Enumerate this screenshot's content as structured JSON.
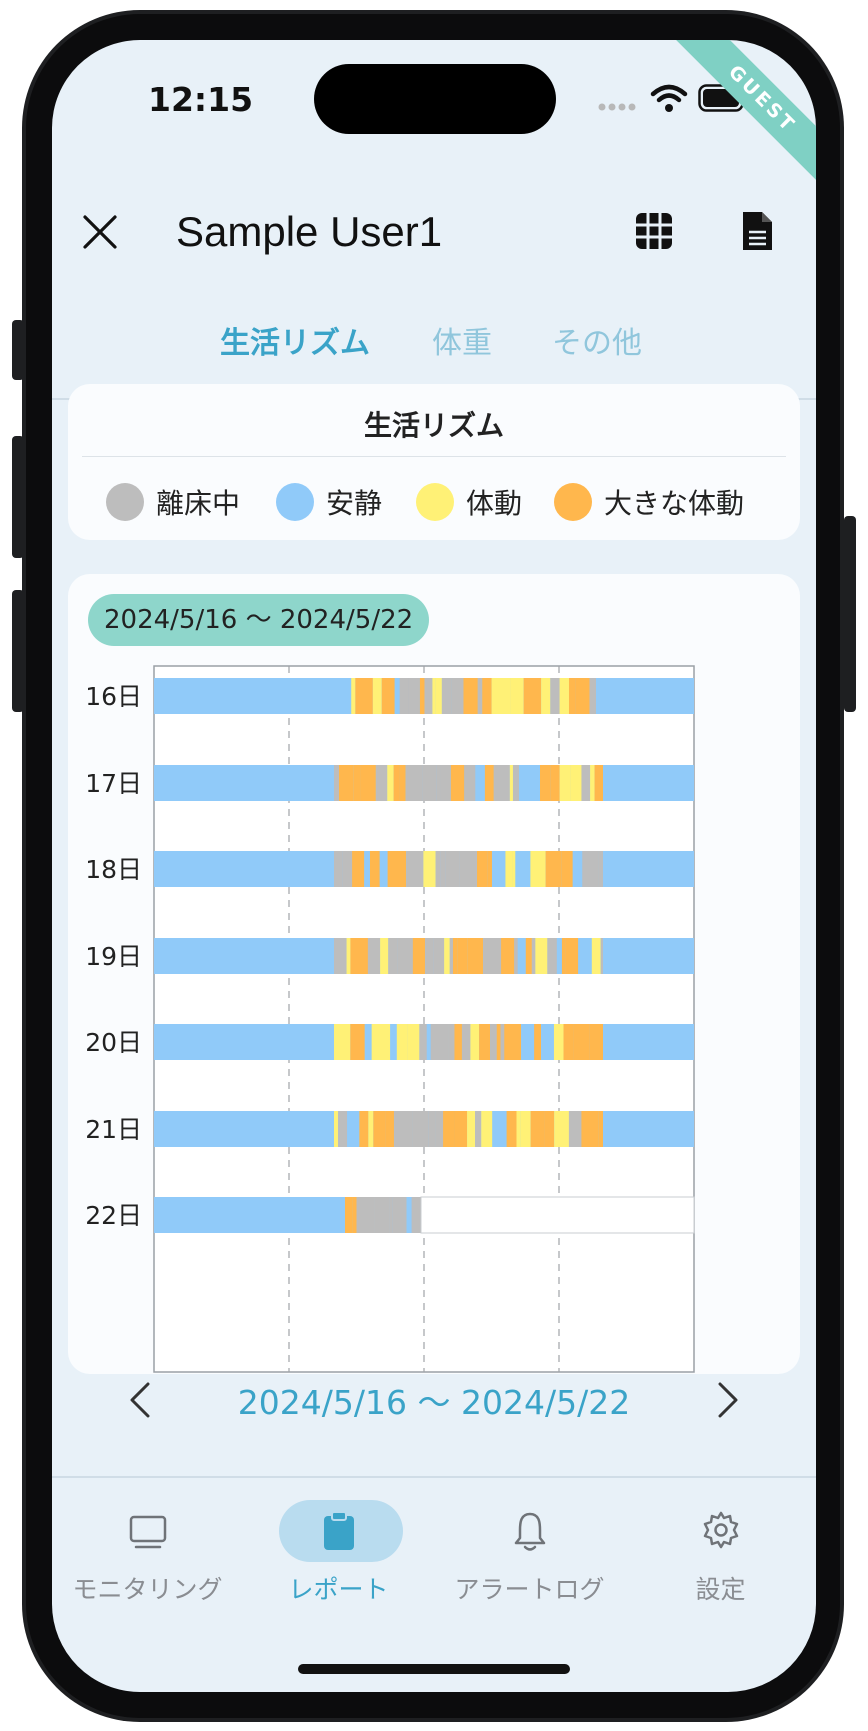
{
  "status": {
    "time": "12:15",
    "badge": "GUEST"
  },
  "header": {
    "title": "Sample User1"
  },
  "tabs": [
    {
      "label": "生活リズム",
      "active": true
    },
    {
      "label": "体重",
      "active": false
    },
    {
      "label": "その他",
      "active": false
    }
  ],
  "legend": {
    "title": "生活リズム",
    "items": [
      {
        "label": "離床中",
        "color": "#bdbdbd"
      },
      {
        "label": "安静",
        "color": "#90caf9"
      },
      {
        "label": "体動",
        "color": "#fff176"
      },
      {
        "label": "大きな体動",
        "color": "#ffb74d"
      }
    ]
  },
  "range_label": "2024/5/16 〜 2024/5/22",
  "chart_data": {
    "type": "timeline",
    "rows": [
      "16日",
      "17日",
      "18日",
      "19日",
      "20日",
      "21日",
      "22日"
    ]
  },
  "pager": {
    "range": "2024/5/16 〜 2024/5/22"
  },
  "bottom_nav": [
    {
      "label": "モニタリング",
      "icon": "monitor-icon",
      "active": false
    },
    {
      "label": "レポート",
      "icon": "clipboard-icon",
      "active": true
    },
    {
      "label": "アラートログ",
      "icon": "bell-icon",
      "active": false
    },
    {
      "label": "設定",
      "icon": "gear-icon",
      "active": false
    }
  ]
}
